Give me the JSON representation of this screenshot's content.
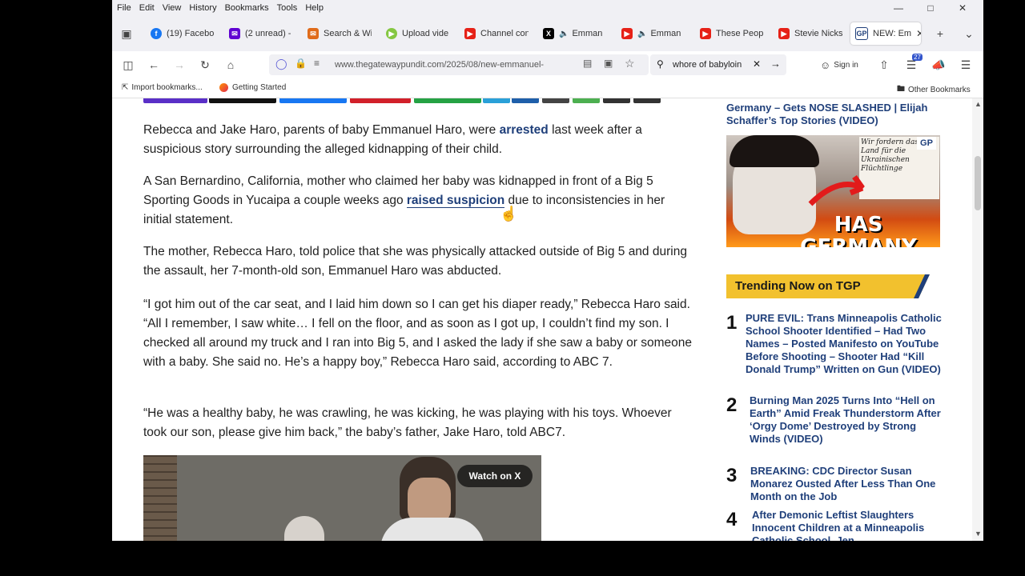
{
  "menubar": {
    "items": [
      "File",
      "Edit",
      "View",
      "History",
      "Bookmarks",
      "Tools",
      "Help"
    ]
  },
  "tabs": [
    {
      "label": "(19) Facebo",
      "icon": "facebook-icon",
      "color": "#1877f2"
    },
    {
      "label": "(2 unread) -",
      "icon": "yahoo-mail-icon",
      "color": "#6001d2"
    },
    {
      "label": "Search & Wi",
      "icon": "search-wi-icon",
      "color": "#e06b1a"
    },
    {
      "label": "Upload vide",
      "icon": "rumble-icon",
      "color": "#85c742"
    },
    {
      "label": "Channel con",
      "icon": "youtube-icon",
      "color": "#e62117"
    },
    {
      "label": "Emman",
      "icon": "x-icon",
      "color": "#000000"
    },
    {
      "label": "Emman",
      "icon": "youtube-icon",
      "color": "#e62117"
    },
    {
      "label": "These Peopl",
      "icon": "youtube-icon",
      "color": "#e62117"
    },
    {
      "label": "Stevie Nicks",
      "icon": "youtube-icon",
      "color": "#e62117"
    },
    {
      "label": "NEW: Em",
      "icon": "gp-icon",
      "color": "#1f3f7a"
    }
  ],
  "nav": {
    "url": "www.thegatewaypundit.com/2025/08/new-emmanuel-",
    "search_value": "whore of babyloin",
    "sign_in": "Sign in",
    "badge": "27"
  },
  "bookmarks": {
    "import": "Import bookmarks...",
    "getting_started": "Getting Started",
    "other": "Other Bookmarks"
  },
  "article": {
    "p1_a": "Rebecca and Jake Haro, parents of baby Emmanuel Haro, were ",
    "p1_link": "arrested",
    "p1_b": " last week after a suspicious story surrounding the alleged kidnapping of their child.",
    "p2_a": "A San Bernardino, California, mother who claimed her baby was kidnapped in front of a Big 5 Sporting Goods in Yucaipa a couple weeks ago ",
    "p2_link": "raised suspicion",
    "p2_b": " due to inconsistencies in her initial statement.",
    "p3": "The mother, Rebecca Haro, told police that she was physically attacked outside of Big 5 and during the assault, her 7-month-old son, Emmanuel Haro was abducted.",
    "p4": "“I got him out of the car seat, and I laid him down so I can get his diaper ready,” Rebecca Haro said. “All I remember, I saw white… I fell on the floor, and as soon as I got up, I couldn’t find my son. I checked all around my truck and I ran into Big 5, and I asked the lady if she saw a baby or someone with a baby. She said no. He’s a happy boy,” Rebecca Haro said, according to ABC 7.",
    "p5": "“He was a healthy baby, he was crawling, he was kicking, he was playing with his toys. Whoever took our son, please give him back,” the baby’s father, Jake Haro, told ABC7.",
    "watch_on_x": "Watch on X"
  },
  "sidebar": {
    "prev_title": "Germany – Gets NOSE SLASHED | Elijah Schaffer’s Top Stories (VIDEO)",
    "thumb_text": "HAS GERMANY FALLEN?",
    "thumb_logo": "GP",
    "thumb_sign": "Wir fordern das Land für die Ukrainischen Flüchtlinge",
    "trending_title": "Trending Now on TGP",
    "trending": [
      {
        "num": "1",
        "title": "PURE EVIL: Trans Minneapolis Catholic School Shooter Identified – Had Two Names – Posted Manifesto on YouTube Before Shooting – Shooter Had “Kill Donald Trump” Written on Gun (VIDEO)"
      },
      {
        "num": "2",
        "title": "Burning Man 2025 Turns Into “Hell on Earth” Amid Freak Thunderstorm After ‘Orgy Dome’ Destroyed by Strong Winds (VIDEO)"
      },
      {
        "num": "3",
        "title": "BREAKING: CDC Director Susan Monarez Ousted After Less Than One Month on the Job"
      },
      {
        "num": "4",
        "title": "After Demonic Leftist Slaughters Innocent Children at a Minneapolis Catholic School, Jen"
      }
    ]
  },
  "colors": {
    "link": "#1f3f7a",
    "trend_bg": "#f2c12e"
  }
}
